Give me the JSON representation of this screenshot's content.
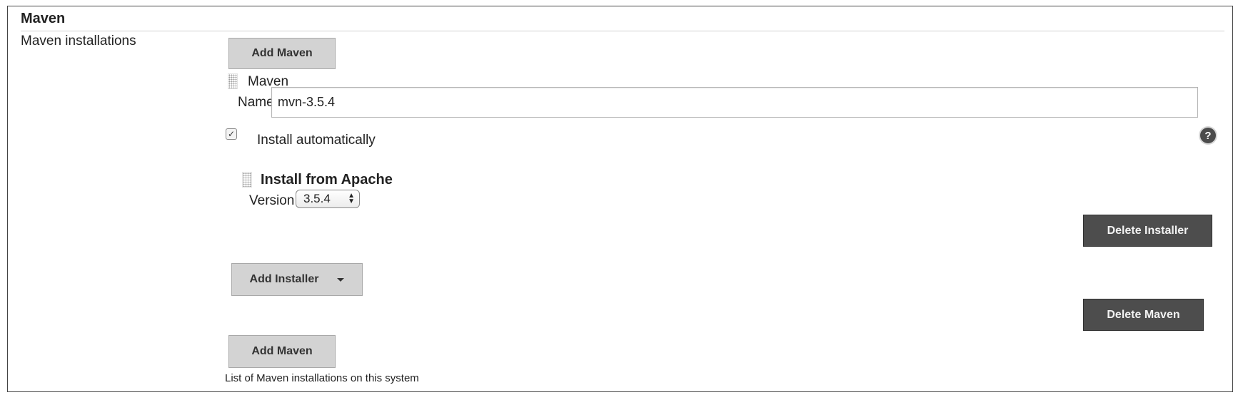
{
  "section": {
    "title": "Maven"
  },
  "maven_installations": {
    "label": "Maven installations",
    "add_maven_label": "Add Maven",
    "item": {
      "header": "Maven",
      "name_label": "Name",
      "name_value": "mvn-3.5.4",
      "install_automatically_label": "Install automatically",
      "install_automatically_checked": true,
      "installer": {
        "title": "Install from Apache",
        "version_label": "Version",
        "version_value": "3.5.4",
        "delete_installer_label": "Delete Installer"
      },
      "add_installer_label": "Add Installer",
      "delete_maven_label": "Delete Maven"
    },
    "description": "List of Maven installations on this system"
  }
}
